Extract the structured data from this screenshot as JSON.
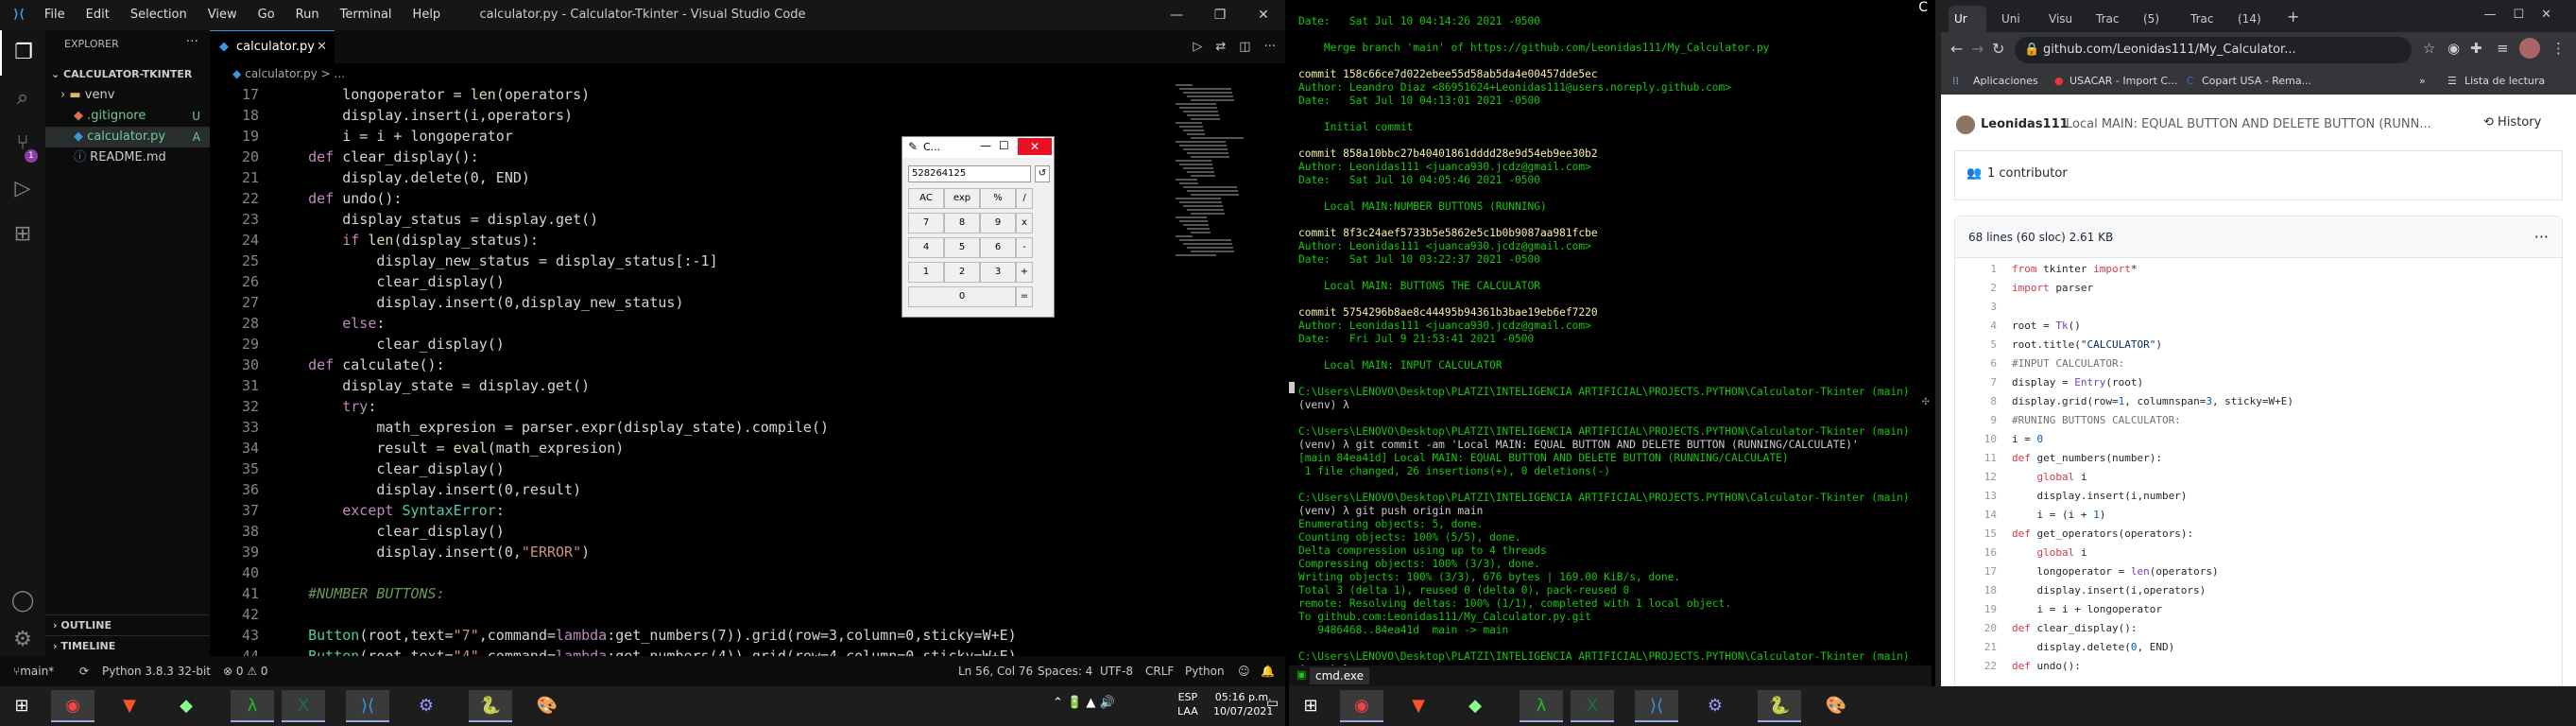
{
  "vscode": {
    "menu": [
      "File",
      "Edit",
      "Selection",
      "View",
      "Go",
      "Run",
      "Terminal",
      "Help"
    ],
    "title": "calculator.py - Calculator-Tkinter - Visual Studio Code",
    "explorer_label": "EXPLORER",
    "project": "CALCULATOR-TKINTER",
    "files": [
      {
        "name": "venv",
        "mark": ""
      },
      {
        "name": ".gitignore",
        "mark": "U"
      },
      {
        "name": "calculator.py",
        "mark": "A"
      },
      {
        "name": "README.md",
        "mark": ""
      }
    ],
    "outline": "OUTLINE",
    "timeline": "TIMELINE",
    "tab": "calculator.py",
    "breadcrumb": "calculator.py > ...",
    "scm_badge": "1",
    "lines": [
      {
        "n": "17",
        "t": "        longoperator = len(operators)"
      },
      {
        "n": "18",
        "t": "        display.insert(i,operators)"
      },
      {
        "n": "19",
        "t": "        i = i + longoperator"
      },
      {
        "n": "20",
        "t": "    def clear_display():"
      },
      {
        "n": "21",
        "t": "        display.delete(0, END)"
      },
      {
        "n": "22",
        "t": "    def undo():"
      },
      {
        "n": "23",
        "t": "        display_status = display.get()"
      },
      {
        "n": "24",
        "t": "        if len(display_status):"
      },
      {
        "n": "25",
        "t": "            display_new_status = display_status[:-1]"
      },
      {
        "n": "26",
        "t": "            clear_display()"
      },
      {
        "n": "27",
        "t": "            display.insert(0,display_new_status)"
      },
      {
        "n": "28",
        "t": "        else:"
      },
      {
        "n": "29",
        "t": "            clear_display()"
      },
      {
        "n": "30",
        "t": "    def calculate():"
      },
      {
        "n": "31",
        "t": "        display_state = display.get()"
      },
      {
        "n": "32",
        "t": "        try:"
      },
      {
        "n": "33",
        "t": "            math_expresion = parser.expr(display_state).compile()"
      },
      {
        "n": "34",
        "t": "            result = eval(math_expresion)"
      },
      {
        "n": "35",
        "t": "            clear_display()"
      },
      {
        "n": "36",
        "t": "            display.insert(0,result)"
      },
      {
        "n": "37",
        "t": "        except SyntaxError:"
      },
      {
        "n": "38",
        "t": "            clear_display()"
      },
      {
        "n": "39",
        "t": "            display.insert(0,\"ERROR\")"
      },
      {
        "n": "40",
        "t": ""
      },
      {
        "n": "41",
        "t": "    #NUMBER BUTTONS:"
      },
      {
        "n": "42",
        "t": ""
      },
      {
        "n": "43",
        "t": "    Button(root,text=\"7\",command=lambda:get_numbers(7)).grid(row=3,column=0,sticky=W+E)"
      },
      {
        "n": "44",
        "t": "    Button(root,text=\"4\",command=lambda:get_numbers(4)).grid(row=4,column=0,sticky=W+E)"
      }
    ],
    "status": {
      "branch": "main*",
      "python": "Python 3.8.3 32-bit",
      "problems": "⊗ 0 ⚠ 0",
      "position": "Ln 56, Col 76",
      "spaces": "Spaces: 4",
      "encoding": "UTF-8",
      "eol": "CRLF",
      "lang": "Python"
    }
  },
  "calc": {
    "title": "C...",
    "display": "528264125",
    "buttons": [
      [
        "AC",
        "exp",
        "%",
        "/"
      ],
      [
        "7",
        "8",
        "9",
        "x"
      ],
      [
        "4",
        "5",
        "6",
        "-"
      ],
      [
        "1",
        "2",
        "3",
        "+"
      ],
      [
        "0",
        "="
      ]
    ]
  },
  "cmd": {
    "tab": "cmd.exe",
    "title": "C",
    "lines": [
      {
        "c": "cg",
        "t": "Date:   Sat Jul 10 04:14:26 2021 -0500"
      },
      {
        "c": "cg",
        "t": ""
      },
      {
        "c": "cg",
        "t": "    Merge branch 'main' of https://github.com/Leonidas111/My_Calculator.py"
      },
      {
        "c": "cg",
        "t": ""
      },
      {
        "c": "cyel",
        "t": "commit 158c66ce7d022ebee55d58ab5da4e00457dde5ec"
      },
      {
        "c": "cg",
        "t": "Author: Leandro Diaz <86951624+Leonidas111@users.noreply.github.com>"
      },
      {
        "c": "cg",
        "t": "Date:   Sat Jul 10 04:13:01 2021 -0500"
      },
      {
        "c": "cg",
        "t": ""
      },
      {
        "c": "cg",
        "t": "    Initial commit"
      },
      {
        "c": "cg",
        "t": ""
      },
      {
        "c": "cyel",
        "t": "commit 858a10bbc27b40401861dddd28e9d54eb9ee30b2"
      },
      {
        "c": "cg",
        "t": "Author: Leonidas111 <juanca930.jcdz@gmail.com>"
      },
      {
        "c": "cg",
        "t": "Date:   Sat Jul 10 04:05:46 2021 -0500"
      },
      {
        "c": "cg",
        "t": ""
      },
      {
        "c": "cg",
        "t": "    Local MAIN:NUMBER BUTTONS (RUNNING)"
      },
      {
        "c": "cg",
        "t": ""
      },
      {
        "c": "cyel",
        "t": "commit 8f3c24aef5733b5e5862e5c1b0b9087aa981fcbe"
      },
      {
        "c": "cg",
        "t": "Author: Leonidas111 <juanca930.jcdz@gmail.com>"
      },
      {
        "c": "cg",
        "t": "Date:   Sat Jul 10 03:22:37 2021 -0500"
      },
      {
        "c": "cg",
        "t": ""
      },
      {
        "c": "cg",
        "t": "    Local MAIN: BUTTONS THE CALCULATOR"
      },
      {
        "c": "cg",
        "t": ""
      },
      {
        "c": "cyel",
        "t": "commit 5754296b8ae8c44495b94361b3bae19eb6ef7220"
      },
      {
        "c": "cg",
        "t": "Author: Leonidas111 <juanca930.jcdz@gmail.com>"
      },
      {
        "c": "cg",
        "t": "Date:   Fri Jul 9 21:53:41 2021 -0500"
      },
      {
        "c": "cg",
        "t": ""
      },
      {
        "c": "cg",
        "t": "    Local MAIN: INPUT CALCULATOR"
      },
      {
        "c": "cg",
        "t": ""
      },
      {
        "c": "cg",
        "t": "C:\\Users\\LENOVO\\Desktop\\PLATZI\\INTELIGENCIA ARTIFICIAL\\PROJECTS.PYTHON\\Calculator-Tkinter (main)"
      },
      {
        "c": "cw",
        "t": "(venv) λ"
      },
      {
        "c": "cg",
        "t": ""
      },
      {
        "c": "cg",
        "t": "C:\\Users\\LENOVO\\Desktop\\PLATZI\\INTELIGENCIA ARTIFICIAL\\PROJECTS.PYTHON\\Calculator-Tkinter (main)"
      },
      {
        "c": "cw",
        "t": "(venv) λ git commit -am 'Local MAIN: EQUAL BUTTON AND DELETE BUTTON (RUNNING/CALCULATE)'"
      },
      {
        "c": "cg",
        "t": "[main 84ea41d] Local MAIN: EQUAL BUTTON AND DELETE BUTTON (RUNNING/CALCULATE)"
      },
      {
        "c": "cg",
        "t": " 1 file changed, 26 insertions(+), 0 deletions(-)"
      },
      {
        "c": "cg",
        "t": ""
      },
      {
        "c": "cg",
        "t": "C:\\Users\\LENOVO\\Desktop\\PLATZI\\INTELIGENCIA ARTIFICIAL\\PROJECTS.PYTHON\\Calculator-Tkinter (main)"
      },
      {
        "c": "cw",
        "t": "(venv) λ git push origin main"
      },
      {
        "c": "cg",
        "t": "Enumerating objects: 5, done."
      },
      {
        "c": "cg",
        "t": "Counting objects: 100% (5/5), done."
      },
      {
        "c": "cg",
        "t": "Delta compression using up to 4 threads"
      },
      {
        "c": "cg",
        "t": "Compressing objects: 100% (3/3), done."
      },
      {
        "c": "cg",
        "t": "Writing objects: 100% (3/3), 676 bytes | 169.00 KiB/s, done."
      },
      {
        "c": "cg",
        "t": "Total 3 (delta 1), reused 0 (delta 0), pack-reused 0"
      },
      {
        "c": "cg",
        "t": "remote: Resolving deltas: 100% (1/1), completed with 1 local object."
      },
      {
        "c": "cg",
        "t": "To github.com:Leonidas111/My_Calculator.py.git"
      },
      {
        "c": "cg",
        "t": "   9486468..84ea41d  main -> main"
      },
      {
        "c": "cg",
        "t": ""
      },
      {
        "c": "cg",
        "t": "C:\\Users\\LENOVO\\Desktop\\PLATZI\\INTELIGENCIA ARTIFICIAL\\PROJECTS.PYTHON\\Calculator-Tkinter (main)"
      },
      {
        "c": "cw",
        "t": "(venv) λ"
      }
    ]
  },
  "browser": {
    "tabs": [
      "Ur",
      "Uni",
      "Visu",
      "Trac",
      "(5)",
      "Trac",
      "(14)"
    ],
    "url": "github.com/Leonidas111/My_Calculator...",
    "bookmarks": [
      "Aplicaciones",
      "USACAR - Import C...",
      "Copart USA - Rema..."
    ],
    "reading_list": "Lista de lectura",
    "commit_author": "Leonidas111",
    "commit_msg": "Local MAIN: EQUAL BUTTON AND DELETE BUTTON (RUNN...",
    "history": "History",
    "contributors": "1 contributor",
    "file_info": "68 lines (60 sloc)   2.61 KB",
    "code": [
      {
        "n": "1",
        "t": "from tkinter import*"
      },
      {
        "n": "2",
        "t": "import parser"
      },
      {
        "n": "3",
        "t": ""
      },
      {
        "n": "4",
        "t": "root = Tk()"
      },
      {
        "n": "5",
        "t": "root.title(\"CALCULATOR\")"
      },
      {
        "n": "6",
        "t": "#INPUT CALCULATOR:"
      },
      {
        "n": "7",
        "t": "display = Entry(root)"
      },
      {
        "n": "8",
        "t": "display.grid(row=1, columnspan=3, sticky=W+E)"
      },
      {
        "n": "9",
        "t": "#RUNING BUTTONS CALCULATOR:"
      },
      {
        "n": "10",
        "t": "i = 0"
      },
      {
        "n": "11",
        "t": "def get_numbers(number):"
      },
      {
        "n": "12",
        "t": "    global i"
      },
      {
        "n": "13",
        "t": "    display.insert(i,number)"
      },
      {
        "n": "14",
        "t": "    i = (i + 1)"
      },
      {
        "n": "15",
        "t": "def get_operators(operators):"
      },
      {
        "n": "16",
        "t": "    global i"
      },
      {
        "n": "17",
        "t": "    longoperator = len(operators)"
      },
      {
        "n": "18",
        "t": "    display.insert(i,operators)"
      },
      {
        "n": "19",
        "t": "    i = i + longoperator"
      },
      {
        "n": "20",
        "t": "def clear_display():"
      },
      {
        "n": "21",
        "t": "    display.delete(0, END)"
      },
      {
        "n": "22",
        "t": "def undo():"
      }
    ]
  },
  "tray": {
    "lang": "ESP",
    "lang2": "LAA",
    "time": "05:16 p.m.",
    "date": "10/07/2021"
  }
}
